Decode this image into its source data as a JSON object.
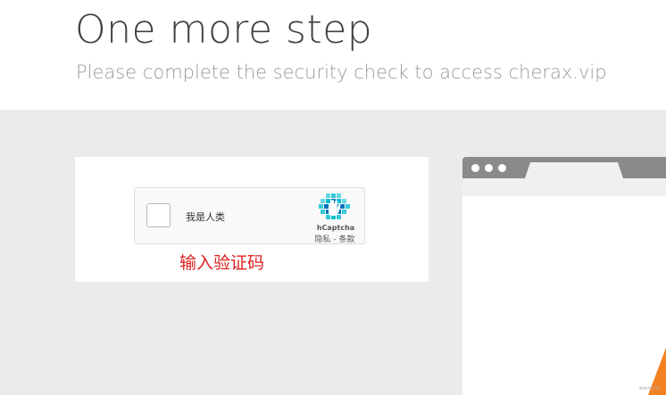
{
  "header": {
    "title": "One more step",
    "subtitle": "Please complete the security check to access cherax.vip"
  },
  "captcha": {
    "checkbox_label": "我是人类",
    "brand": "hCaptcha",
    "privacy_link": "隐私",
    "separator": " - ",
    "terms_link": "条款",
    "instruction": "输入验证码"
  },
  "watermark": "www.hz",
  "icons": {
    "logo": "hcaptcha-logo-icon",
    "browser_dots": "window-dots-icon"
  },
  "colors": {
    "instruction_text": "#e02020",
    "hcaptcha_brand": "#0074bf",
    "hcaptcha_light": "#00bfd1",
    "page_background": "#ebebeb",
    "accent_corner": "#f48120"
  }
}
